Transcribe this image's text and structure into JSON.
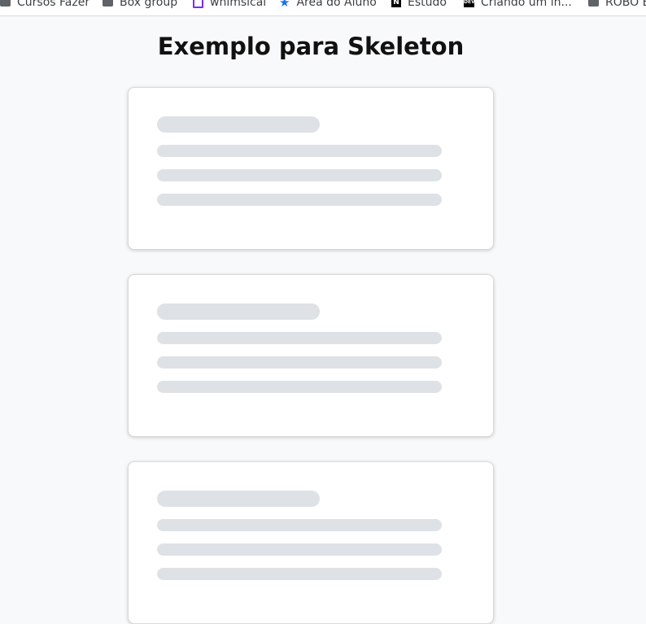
{
  "bookmarks": [
    {
      "label": "Cursos Fazer",
      "icon": "folder-icon"
    },
    {
      "label": "Box group",
      "icon": "folder-icon"
    },
    {
      "label": "whimsical",
      "icon": "whimsical-icon"
    },
    {
      "label": "Área do Aluno",
      "icon": "star-icon"
    },
    {
      "label": "Estudo",
      "icon": "notion-icon"
    },
    {
      "label": "Criando um in...",
      "icon": "dev-icon"
    },
    {
      "label": "ROBÔ E",
      "icon": "folder-icon"
    }
  ],
  "page": {
    "title": "Exemplo para Skeleton"
  },
  "cards": [
    {
      "state": "loading"
    },
    {
      "state": "loading"
    },
    {
      "state": "loading"
    }
  ],
  "colors": {
    "background": "#f8f9fa",
    "card": "#ffffff",
    "skeleton": "#dee2e6",
    "title": "#111111"
  }
}
